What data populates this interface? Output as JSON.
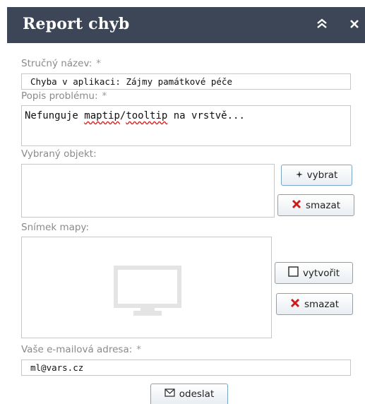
{
  "dialog": {
    "title": "Report chyb",
    "collapse_icon": "double-chevron-up-icon",
    "close_icon": "close-icon"
  },
  "form": {
    "short_name": {
      "label": "Stručný název:",
      "required_mark": "*",
      "value": "Chyba v aplikaci: Zájmy památkové péče"
    },
    "description": {
      "label": "Popis problému:",
      "required_mark": "*",
      "value_plain_1": "Nefunguje ",
      "value_misspelled_1": "maptip",
      "value_plain_2": "/",
      "value_misspelled_2": "tooltip",
      "value_plain_3": " na vrstvě..."
    },
    "selected_object": {
      "label": "Vybraný objekt:",
      "select_button": "vybrat",
      "delete_button": "smazat"
    },
    "map_snapshot": {
      "label": "Snímek mapy:",
      "placeholder_icon": "monitor-icon",
      "create_button": "vytvořit",
      "delete_button": "smazat"
    },
    "email": {
      "label": "Vaše e-mailová adresa:",
      "required_mark": "*",
      "value": "ml@vars.cz"
    },
    "submit_button": "odeslat"
  },
  "colors": {
    "titlebar": "#3c4657",
    "button_border": "#7aa6c6",
    "delete_icon": "#cc1b1b"
  }
}
